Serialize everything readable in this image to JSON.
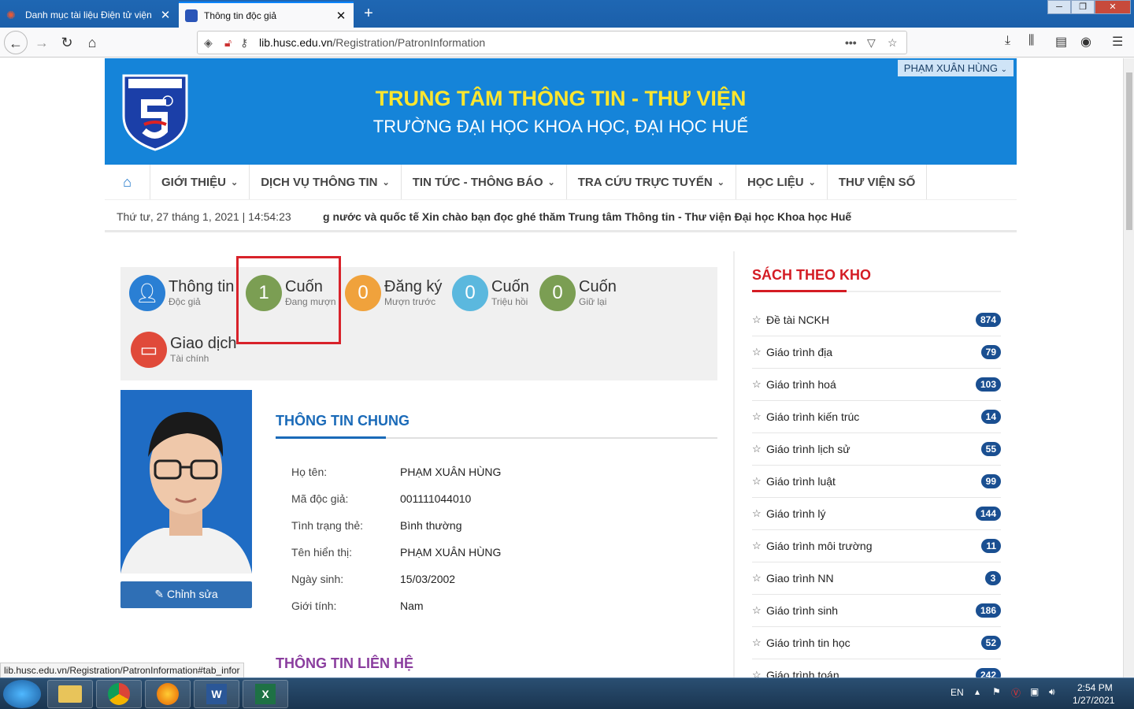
{
  "browser": {
    "tabs": [
      {
        "title": "Danh mục tài liệu Điện tử viện",
        "active": false
      },
      {
        "title": "Thông tin độc giả",
        "active": true
      }
    ],
    "url_domain": "lib.husc.edu.vn",
    "url_path": "/Registration/PatronInformation",
    "status_url": "lib.husc.edu.vn/Registration/PatronInformation#tab_infor"
  },
  "header": {
    "user_menu": "PHẠM XUÂN HÙNG",
    "title": "TRUNG TÂM THÔNG TIN - THƯ VIỆN",
    "subtitle": "TRƯỜNG ĐẠI HỌC KHOA HỌC, ĐẠI HỌC HUẾ"
  },
  "nav": {
    "items": [
      "GIỚI THIỆU",
      "DỊCH VỤ THÔNG TIN",
      "TIN TỨC - THÔNG BÁO",
      "TRA CỨU TRỰC TUYẾN",
      "HỌC LIỆU",
      "THƯ VIỆN SỐ"
    ]
  },
  "ticker": {
    "date": "Thứ tư, 27 tháng 1, 2021 | 14:54:23",
    "message": "g nước và quốc tế Xin chào bạn đọc ghé thăm Trung tâm Thông tin - Thư viện Đại học Khoa học Huế"
  },
  "stats": {
    "info": {
      "title": "Thông tin",
      "sub": "Độc giả"
    },
    "borrowing": {
      "count": "1",
      "title": "Cuốn",
      "sub": "Đang mượn"
    },
    "reserve": {
      "count": "0",
      "title": "Đăng ký",
      "sub": "Mượn trước"
    },
    "recall": {
      "count": "0",
      "title": "Cuốn",
      "sub": "Triệu hồi"
    },
    "hold": {
      "count": "0",
      "title": "Cuốn",
      "sub": "Giữ lại"
    },
    "finance": {
      "title": "Giao dịch",
      "sub": "Tài chính"
    }
  },
  "profile": {
    "edit_label": "Chỉnh sửa",
    "section_title": "THÔNG TIN CHUNG",
    "fields": [
      {
        "label": "Họ tên:",
        "value": "PHẠM XUÂN HÙNG"
      },
      {
        "label": "Mã độc giả:",
        "value": "001111044010"
      },
      {
        "label": "Tình trạng thẻ:",
        "value": "Bình thường"
      },
      {
        "label": "Tên hiển thị:",
        "value": "PHẠM XUÂN HÙNG"
      },
      {
        "label": "Ngày sinh:",
        "value": "15/03/2002"
      },
      {
        "label": "Giới tính:",
        "value": "Nam"
      }
    ],
    "contact_title": "THÔNG TIN LIÊN HỆ"
  },
  "sidebar": {
    "title": "SÁCH THEO KHO",
    "items": [
      {
        "label": "Đề tài NCKH",
        "count": "874"
      },
      {
        "label": "Giáo trình địa",
        "count": "79"
      },
      {
        "label": "Giáo trình hoá",
        "count": "103"
      },
      {
        "label": "Giáo trình kiến trúc",
        "count": "14"
      },
      {
        "label": "Giáo trình lịch sử",
        "count": "55"
      },
      {
        "label": "Giáo trình luật",
        "count": "99"
      },
      {
        "label": "Giáo trình lý",
        "count": "144"
      },
      {
        "label": "Giáo trình môi trường",
        "count": "11"
      },
      {
        "label": "Giao trình NN",
        "count": "3"
      },
      {
        "label": "Giáo trình sinh",
        "count": "186"
      },
      {
        "label": "Giáo trình tin học",
        "count": "52"
      },
      {
        "label": "Giáo trình toán",
        "count": "242"
      }
    ]
  },
  "taskbar": {
    "lang": "EN",
    "time": "2:54 PM",
    "date": "1/27/2021"
  },
  "colors": {
    "header_blue": "#1584d9",
    "title_yellow": "#ffe62e",
    "badge_blue": "#1a4f91",
    "accent_red": "#d41c24",
    "highlight_red": "#d8222a"
  }
}
